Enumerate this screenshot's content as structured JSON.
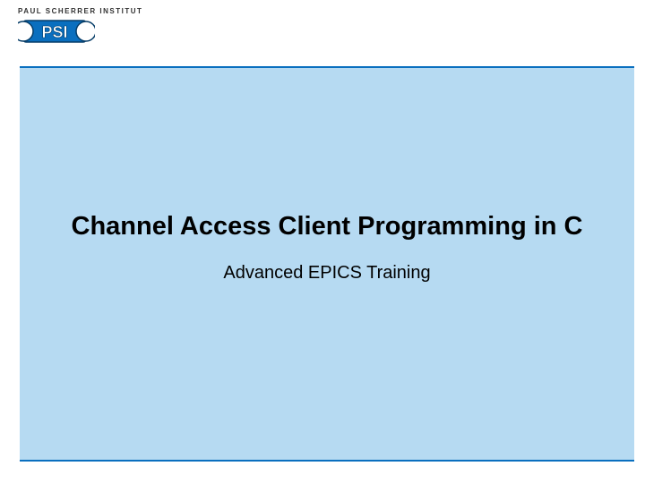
{
  "logo": {
    "tagline": "PAUL SCHERRER INSTITUT",
    "abbr": "PSI"
  },
  "slide": {
    "title": "Channel Access Client Programming in C",
    "subtitle": "Advanced EPICS Training"
  },
  "colors": {
    "accent": "#0a6fbf",
    "panel": "#b6daf2"
  }
}
